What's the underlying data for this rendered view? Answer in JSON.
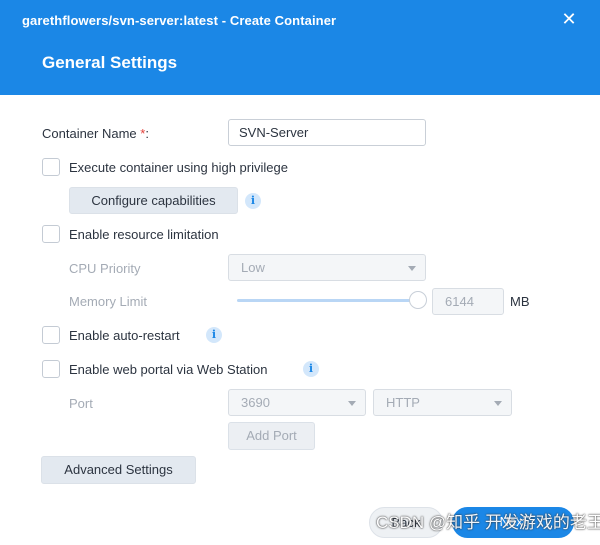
{
  "window": {
    "title": "garethflowers/svn-server:latest - Create Container",
    "close_glyph": "✕"
  },
  "header": {
    "section_title": "General Settings"
  },
  "form": {
    "container_name": {
      "label": "Container Name",
      "required_mark": "*",
      "colon": ":",
      "value": "SVN-Server"
    },
    "high_privilege": {
      "label": "Execute container using high privilege",
      "checked": false
    },
    "configure_capabilities": {
      "label": "Configure capabilities"
    },
    "resource_limitation": {
      "label": "Enable resource limitation",
      "checked": false
    },
    "cpu_priority": {
      "label": "CPU Priority",
      "value": "Low"
    },
    "memory_limit": {
      "label": "Memory Limit",
      "value": "6144",
      "unit": "MB",
      "slider_fraction": 1.0
    },
    "auto_restart": {
      "label": "Enable auto-restart",
      "checked": false
    },
    "web_portal": {
      "label": "Enable web portal via Web Station",
      "checked": false
    },
    "port": {
      "label": "Port",
      "value": "3690",
      "protocol": "HTTP"
    },
    "add_port": {
      "label": "Add Port"
    },
    "info_glyph": "i"
  },
  "advanced_settings": {
    "label": "Advanced Settings"
  },
  "footer": {
    "back_label": "Back",
    "next_label": "Next"
  },
  "watermark": {
    "text": "CSDN @知乎 开发游戏的老王"
  },
  "colors": {
    "accent": "#1b87e6",
    "required": "#e2403a",
    "disabled_text": "#a4abb5"
  }
}
